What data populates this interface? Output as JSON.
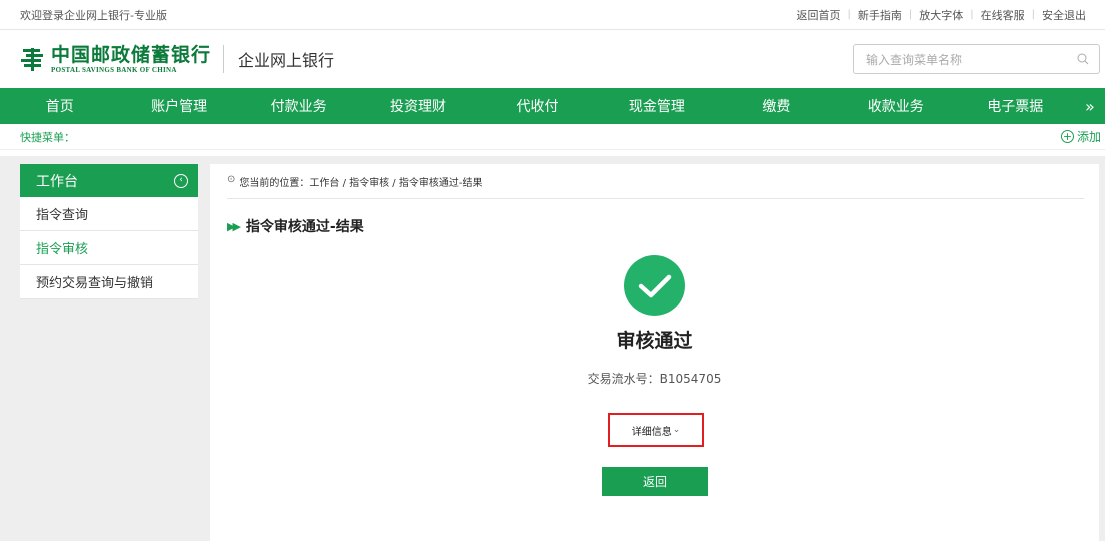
{
  "topbar": {
    "welcome": "欢迎登录企业网上银行-专业版",
    "links": [
      "返回首页",
      "新手指南",
      "放大字体",
      "在线客服",
      "安全退出"
    ]
  },
  "header": {
    "logo_cn": "中国邮政储蓄银行",
    "logo_en": "POSTAL SAVINGS BANK OF CHINA",
    "subtitle": "企业网上银行",
    "search_placeholder": "输入查询菜单名称"
  },
  "nav": {
    "items": [
      "首页",
      "账户管理",
      "付款业务",
      "投资理财",
      "代收付",
      "现金管理",
      "缴费",
      "收款业务",
      "电子票据"
    ],
    "more": "»"
  },
  "quick": {
    "label": "快捷菜单：",
    "add": "添加"
  },
  "sidebar": {
    "header": "工作台",
    "items": [
      {
        "label": "指令查询"
      },
      {
        "label": "指令审核"
      },
      {
        "label": "预约交易查询与撤销"
      }
    ]
  },
  "main": {
    "breadcrumb": "您当前的位置：工作台 / 指令审核 / 指令审核通过-结果",
    "title": "指令审核通过-结果",
    "status": "审核通过",
    "transaction": "交易流水号：B1054705",
    "detail": "详细信息",
    "back": "返回"
  },
  "colors": {
    "brand_green": "#1a9f52",
    "success_green": "#24b26b",
    "highlight_red": "#e02020"
  }
}
